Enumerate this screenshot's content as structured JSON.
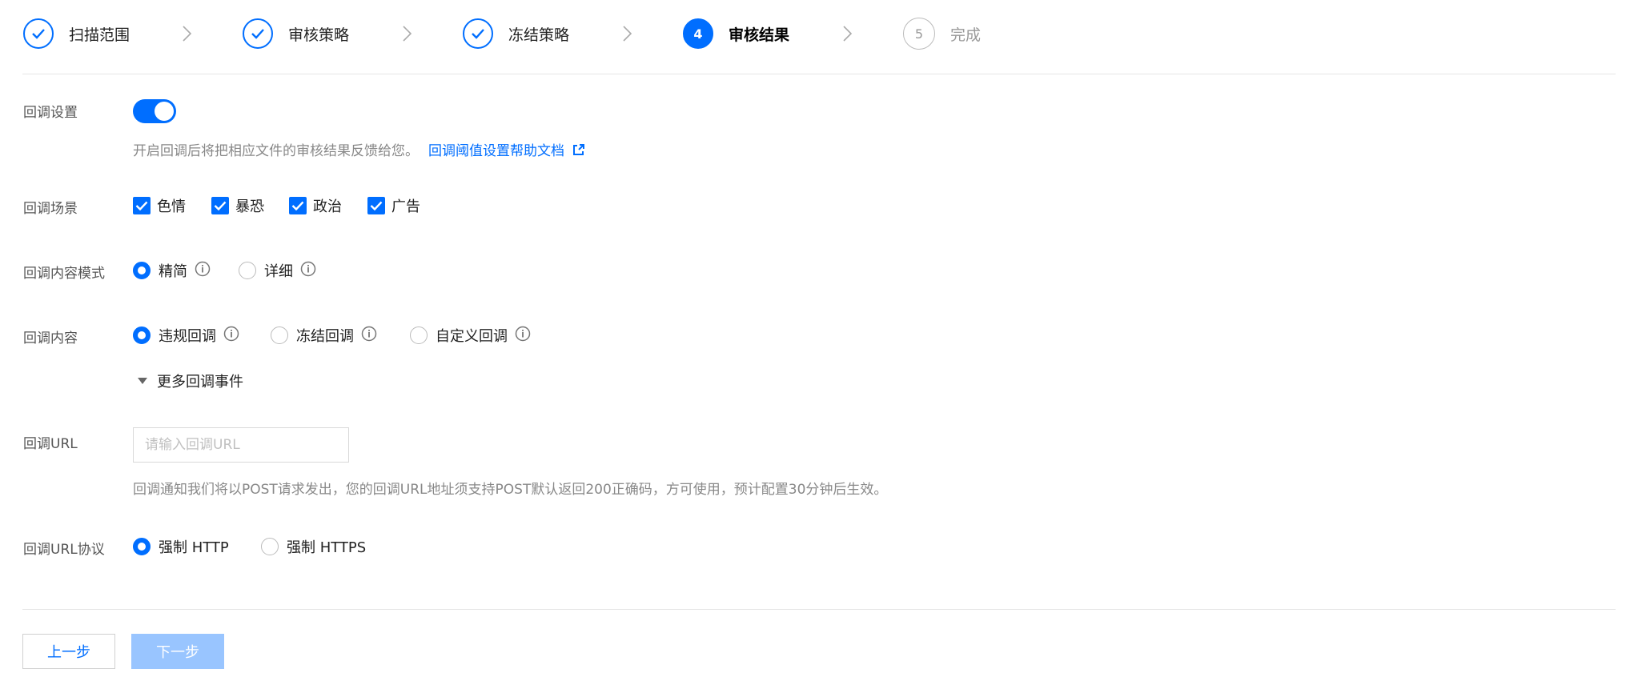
{
  "steps": [
    {
      "label": "扫描范围",
      "state": "done"
    },
    {
      "label": "审核策略",
      "state": "done"
    },
    {
      "label": "冻结策略",
      "state": "done"
    },
    {
      "label": "审核结果",
      "state": "active",
      "num": "4"
    },
    {
      "label": "完成",
      "state": "pending",
      "num": "5"
    }
  ],
  "callback_setting": {
    "label": "回调设置",
    "enabled": true,
    "hint": "开启回调后将把相应文件的审核结果反馈给您。",
    "link": "回调阈值设置帮助文档"
  },
  "scene": {
    "label": "回调场景",
    "options": [
      "色情",
      "暴恐",
      "政治",
      "广告"
    ]
  },
  "mode": {
    "label": "回调内容模式",
    "options": [
      "精简",
      "详细"
    ],
    "selected": "精简"
  },
  "content": {
    "label": "回调内容",
    "options": [
      "违规回调",
      "冻结回调",
      "自定义回调"
    ],
    "selected": "违规回调",
    "more": "更多回调事件"
  },
  "url": {
    "label": "回调URL",
    "placeholder": "请输入回调URL",
    "value": "",
    "hint": "回调通知我们将以POST请求发出，您的回调URL地址须支持POST默认返回200正确码，方可使用，预计配置30分钟后生效。"
  },
  "protocol": {
    "label": "回调URL协议",
    "options": [
      "强制 HTTP",
      "强制 HTTPS"
    ],
    "selected": "强制 HTTP"
  },
  "buttons": {
    "prev": "上一步",
    "next": "下一步"
  },
  "colors": {
    "accent": "#006eff",
    "disabled_button": "#99c5ff"
  }
}
